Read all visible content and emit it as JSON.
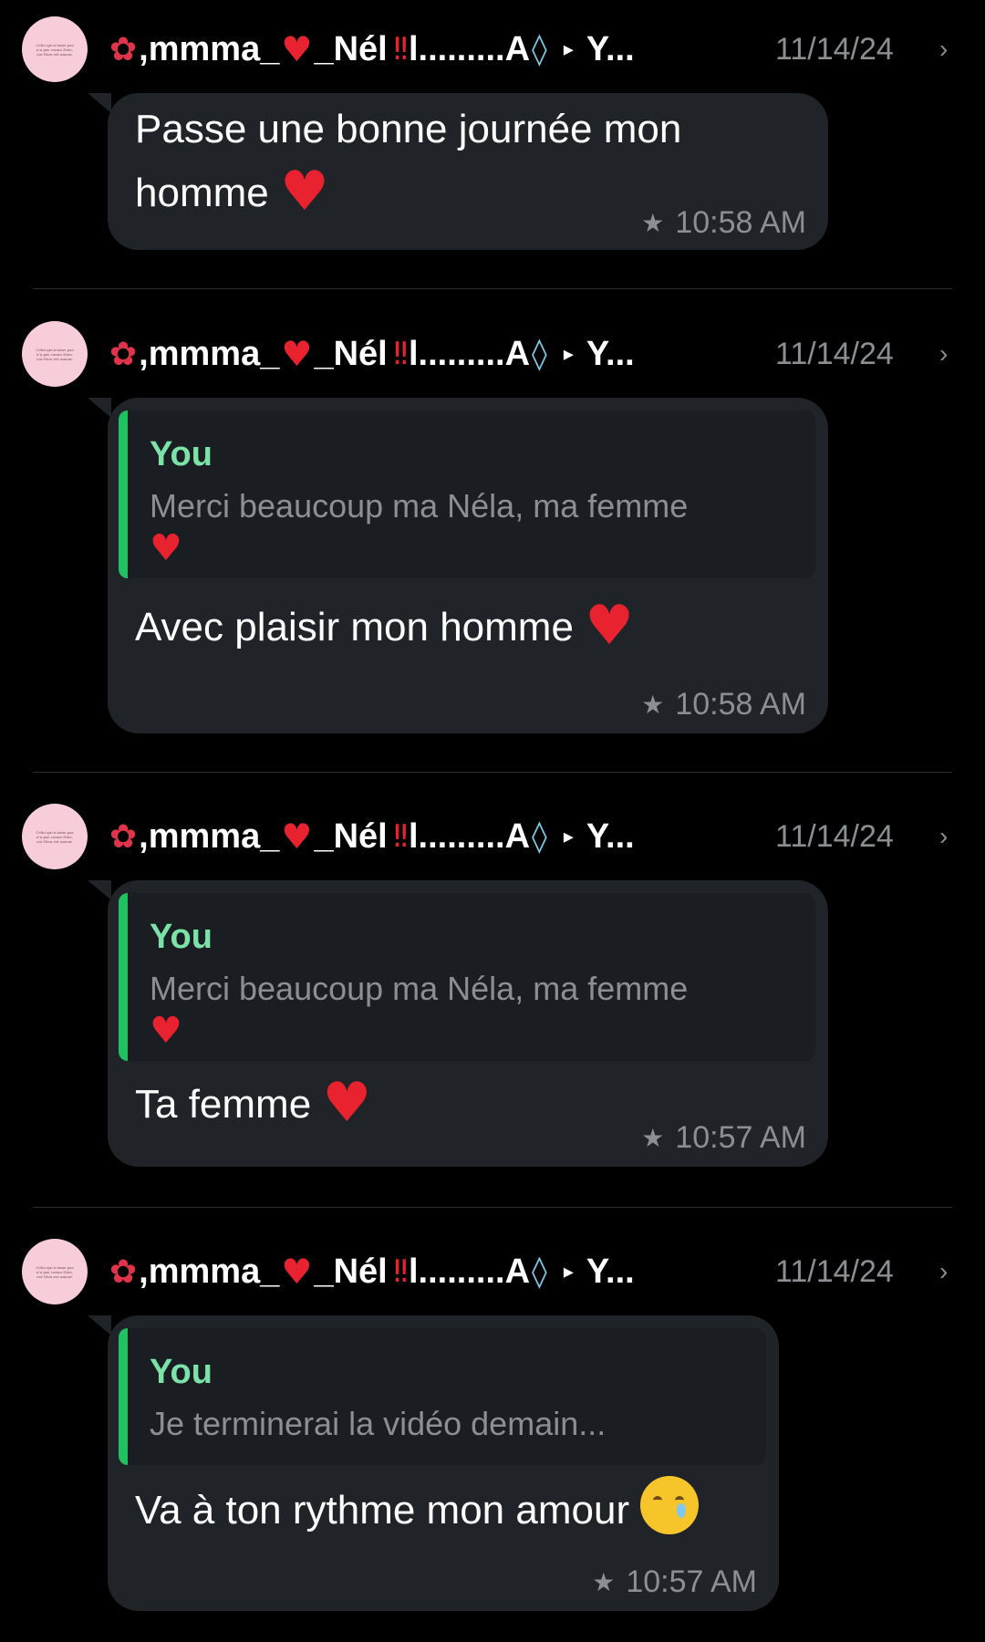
{
  "messages": [
    {
      "sender": {
        "prefix_emoji": "flower-icon",
        "name_part1": ",mmma_",
        "name_part2": "_Nél",
        "name_part3": "l.........A",
        "trailing": "Y..."
      },
      "date": "11/14/24",
      "text": "Passe une bonne journée mon homme",
      "text_emoji": "heart",
      "time": "10:58 AM",
      "starred": true,
      "quote": null
    },
    {
      "sender": {
        "prefix_emoji": "flower-icon",
        "name_part1": ",mmma_",
        "name_part2": "_Nél",
        "name_part3": "l.........A",
        "trailing": "Y..."
      },
      "date": "11/14/24",
      "text": "Avec plaisir mon homme",
      "text_emoji": "heart",
      "time": "10:58 AM",
      "starred": true,
      "quote": {
        "author": "You",
        "text": "Merci beaucoup ma Néla, ma femme"
      }
    },
    {
      "sender": {
        "prefix_emoji": "flower-icon",
        "name_part1": ",mmma_",
        "name_part2": "_Nél",
        "name_part3": "l.........A",
        "trailing": "Y..."
      },
      "date": "11/14/24",
      "text": "Ta femme",
      "text_emoji": "heart",
      "time": "10:57 AM",
      "starred": true,
      "quote": {
        "author": "You",
        "text": "Merci beaucoup ma Néla, ma femme"
      }
    },
    {
      "sender": {
        "prefix_emoji": "flower-icon",
        "name_part1": ",mmma_",
        "name_part2": "_Nél",
        "name_part3": "l.........A",
        "trailing": "Y..."
      },
      "date": "11/14/24",
      "text": "Va à ton rythme mon amour",
      "text_emoji": "smiling-face-with-tear",
      "time": "10:57 AM",
      "starred": true,
      "quote": {
        "author": "You",
        "text": "Je terminerai la vidéo demain..."
      }
    }
  ],
  "avatar_caption": "Celui qui n'aime pas n'a pas connu Dieu, car Dieu est amour.",
  "colors": {
    "background": "#000000",
    "bubble": "#202327",
    "quote_bar": "#21c063",
    "quote_author": "#7be3a7",
    "muted": "#8b8e92"
  }
}
